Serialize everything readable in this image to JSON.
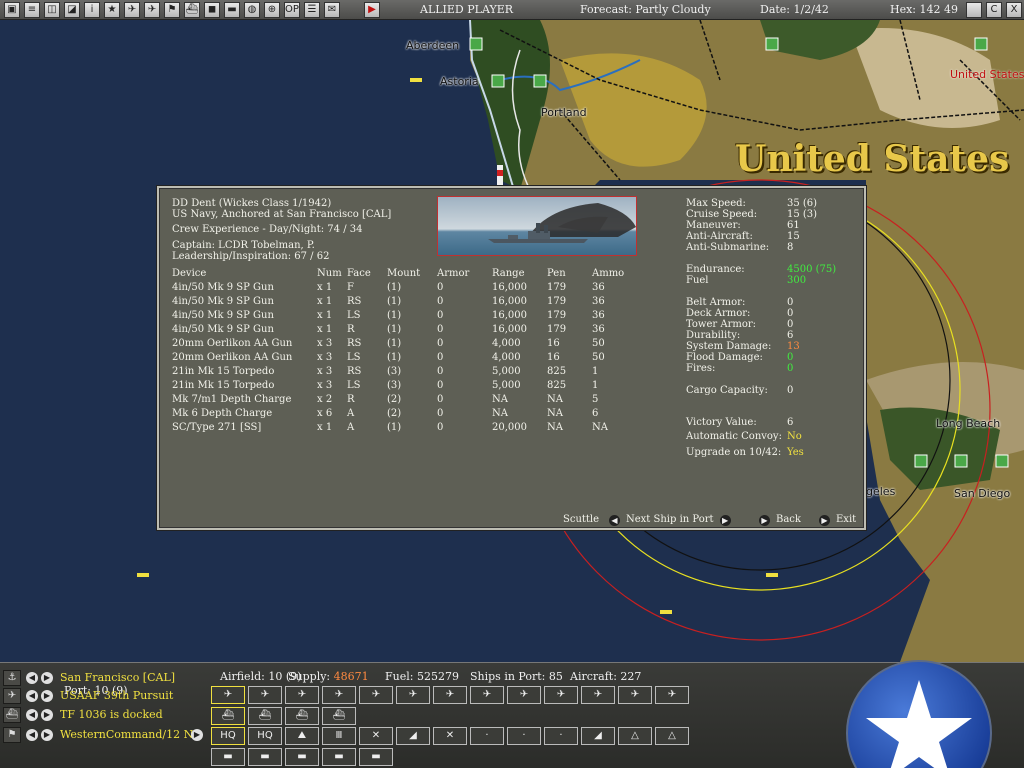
{
  "topbar": {
    "player": "ALLIED PLAYER",
    "forecast": "Forecast: Partly Cloudy",
    "date": "Date: 1/2/42",
    "hex": "Hex: 142 49",
    "icons": [
      "view-icon",
      "report-icon",
      "overview-icon",
      "settings-icon",
      "info-icon",
      "base-icon",
      "air-icon",
      "aircraft-icon",
      "flag-icon",
      "ship-icon",
      "hq-icon",
      "convoy-icon",
      "map-icon",
      "globe-icon",
      "ops-icon",
      "list-icon",
      "message-icon",
      "turn-icon"
    ],
    "right_icons": [
      "flag-icon",
      "c-icon",
      "close-icon"
    ],
    "right_labels": [
      "",
      "C",
      "X"
    ]
  },
  "map": {
    "cities": [
      {
        "name": "Aberdeen"
      },
      {
        "name": "Astoria"
      },
      {
        "name": "Portland"
      },
      {
        "name": "United States"
      },
      {
        "name": "Long Beach"
      },
      {
        "name": "geles"
      },
      {
        "name": "San Diego"
      }
    ],
    "country_label": "United States",
    "colors": {
      "ocean": "#1e2f4e",
      "land": "#8a7a42",
      "forest": "#2f4d22",
      "range_red": "#c82020",
      "range_yellow": "#e8e020"
    }
  },
  "dialog": {
    "header": {
      "ship": "DD Dent (Wickes Class 1/1942)",
      "status": "US Navy, Anchored at San Francisco [CAL]",
      "crew": "Crew Experience - Day/Night: 74 / 34",
      "captain": "Captain: LCDR Tobelman, P.",
      "leadership": "Leadership/Inspiration: 67 / 62"
    },
    "columns": [
      "Device",
      "Num",
      "Face",
      "Mount",
      "Armor",
      "Range",
      "Pen",
      "Ammo"
    ],
    "devices": [
      [
        "4in/50 Mk 9 SP Gun",
        "x 1",
        "F",
        "(1)",
        "0",
        "16,000",
        "179",
        "36"
      ],
      [
        "4in/50 Mk 9 SP Gun",
        "x 1",
        "RS",
        "(1)",
        "0",
        "16,000",
        "179",
        "36"
      ],
      [
        "4in/50 Mk 9 SP Gun",
        "x 1",
        "LS",
        "(1)",
        "0",
        "16,000",
        "179",
        "36"
      ],
      [
        "4in/50 Mk 9 SP Gun",
        "x 1",
        "R",
        "(1)",
        "0",
        "16,000",
        "179",
        "36"
      ],
      [
        "20mm Oerlikon AA Gun",
        "x 3",
        "RS",
        "(1)",
        "0",
        "4,000",
        "16",
        "50"
      ],
      [
        "20mm Oerlikon AA Gun",
        "x 3",
        "LS",
        "(1)",
        "0",
        "4,000",
        "16",
        "50"
      ],
      [
        "21in Mk 15 Torpedo",
        "x 3",
        "RS",
        "(3)",
        "0",
        "5,000",
        "825",
        "1"
      ],
      [
        "21in Mk 15 Torpedo",
        "x 3",
        "LS",
        "(3)",
        "0",
        "5,000",
        "825",
        "1"
      ],
      [
        "Mk 7/m1 Depth Charge",
        "x 2",
        "R",
        "(2)",
        "0",
        "NA",
        "NA",
        "5"
      ],
      [
        "Mk 6 Depth Charge",
        "x 6",
        "A",
        "(2)",
        "0",
        "NA",
        "NA",
        "6"
      ],
      [
        "SC/Type 271 [SS]",
        "x 1",
        "A",
        "(1)",
        "0",
        "20,000",
        "NA",
        "NA"
      ]
    ],
    "stats": [
      {
        "label": "Max Speed:",
        "value": "35 (6)",
        "color": ""
      },
      {
        "label": "Cruise Speed:",
        "value": "15 (3)",
        "color": ""
      },
      {
        "label": "Maneuver:",
        "value": "61",
        "color": ""
      },
      {
        "label": "Anti-Aircraft:",
        "value": "15",
        "color": ""
      },
      {
        "label": "Anti-Submarine:",
        "value": "8",
        "color": ""
      },
      {
        "label": "Endurance:",
        "value": "4500 (75)",
        "color": "green"
      },
      {
        "label": "Fuel",
        "value": "300",
        "color": "green"
      },
      {
        "label": "Belt Armor:",
        "value": "0",
        "color": ""
      },
      {
        "label": "Deck Armor:",
        "value": "0",
        "color": ""
      },
      {
        "label": "Tower Armor:",
        "value": "0",
        "color": ""
      },
      {
        "label": "Durability:",
        "value": "6",
        "color": ""
      },
      {
        "label": "System Damage:",
        "value": "13",
        "color": "orange"
      },
      {
        "label": "Flood Damage:",
        "value": "0",
        "color": "green"
      },
      {
        "label": "Fires:",
        "value": "0",
        "color": "green"
      },
      {
        "label": "Cargo Capacity:",
        "value": "0",
        "color": ""
      },
      {
        "label": "Victory Value:",
        "value": "6",
        "color": ""
      },
      {
        "label": "Automatic Convoy:",
        "value": "No",
        "color": "yellow"
      },
      {
        "label": "Upgrade on 10/42:",
        "value": "Yes",
        "color": "yellow"
      }
    ],
    "buttons": {
      "scuttle": "Scuttle",
      "next": "Next Ship in Port",
      "back": "Back",
      "exit": "Exit"
    }
  },
  "bottom": {
    "rows": [
      {
        "icon": "anchor-icon",
        "label": "San Francisco [CAL]"
      },
      {
        "icon": "plane-icon",
        "label": "USAAF 39th Pursuit"
      },
      {
        "icon": "ship-icon",
        "label": "TF 1036 is docked"
      },
      {
        "icon": "flag-icon",
        "label": "WesternCommand/12 ND"
      }
    ],
    "info": {
      "port": "Port: 10 (9)",
      "airfield": "Airfield: 10 (9)",
      "supply_label": "Supply:",
      "supply_value": "48671",
      "fuel": "Fuel: 525279",
      "ships": "Ships in Port: 85",
      "aircraft": "Aircraft: 227"
    },
    "unit_buttons": {
      "row1": [
        "fighter-icon",
        "fighter-icon",
        "bomber-icon",
        "bomber-icon",
        "bomber-icon",
        "bomber-icon",
        "fighter-icon",
        "fighter-icon",
        "patrol-icon",
        "patrol-icon",
        "bomber-icon",
        "bomber-icon",
        "transport-icon"
      ],
      "row2": [
        "battleship-icon",
        "cargo-ship-icon",
        "submarine-icon",
        "destroyer-icon"
      ],
      "row3": [
        {
          "icon": "hq-icon",
          "label": "HQ"
        },
        {
          "icon": "hq-icon",
          "label": "HQ"
        },
        {
          "icon": "artillery-icon",
          "label": ""
        },
        {
          "icon": "engineer-icon",
          "label": ""
        },
        {
          "icon": "infantry-icon",
          "label": ""
        },
        {
          "icon": "armor-icon",
          "label": ""
        },
        {
          "icon": "infantry-icon",
          "label": ""
        },
        {
          "icon": "base-force-icon",
          "label": ""
        },
        {
          "icon": "base-force-icon",
          "label": ""
        },
        {
          "icon": "base-force-icon",
          "label": ""
        },
        {
          "icon": "artillery-icon",
          "label": ""
        },
        {
          "icon": "aa-icon",
          "label": ""
        },
        {
          "icon": "aa-icon",
          "label": ""
        }
      ],
      "row4": [
        "ammo-icon",
        "factory-icon",
        "supply-icon",
        "fuel-icon",
        "ship-repair-icon"
      ]
    }
  }
}
